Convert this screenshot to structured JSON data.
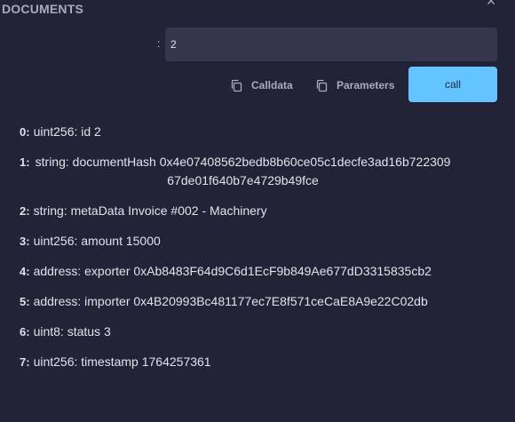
{
  "header": {
    "title": "DOCUMENTS"
  },
  "parameter": {
    "separator": ":",
    "value": "2"
  },
  "buttons": {
    "calldata": "Calldata",
    "parameters": "Parameters",
    "call": "call"
  },
  "results": [
    {
      "index": "0:",
      "text": "uint256: id 2",
      "wrap": false
    },
    {
      "index": "1:",
      "text": "string: documentHash 0x4e07408562bedb8b60ce05c1decfe3ad16b72230967de01f640b7e4729b49fce",
      "wrap": true
    },
    {
      "index": "2:",
      "text": "string: metaData Invoice #002 - Machinery",
      "wrap": false
    },
    {
      "index": "3:",
      "text": "uint256: amount 15000",
      "wrap": false
    },
    {
      "index": "4:",
      "text": "address: exporter 0xAb8483F64d9C6d1EcF9b849Ae677dD3315835cb2",
      "wrap": true
    },
    {
      "index": "5:",
      "text": "address: importer 0x4B20993Bc481177ec7E8f571ceCaE8A9e22C02db",
      "wrap": true
    },
    {
      "index": "6:",
      "text": "uint8: status 3",
      "wrap": false
    },
    {
      "index": "7:",
      "text": "uint256: timestamp 1764257361",
      "wrap": false
    }
  ]
}
